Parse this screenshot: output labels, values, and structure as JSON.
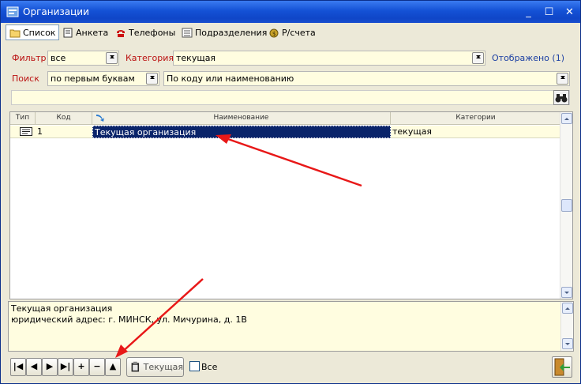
{
  "window": {
    "title": "Организации"
  },
  "titlebar_buttons": [
    "minimize",
    "maximize",
    "close"
  ],
  "tabs": [
    {
      "label": "Список",
      "icon": "folder-icon",
      "active": true
    },
    {
      "label": "Анкета",
      "icon": "book-icon",
      "active": false
    },
    {
      "label": "Телефоны",
      "icon": "phone-icon",
      "active": false
    },
    {
      "label": "Подразделения",
      "icon": "list-icon",
      "active": false
    },
    {
      "label": "Р/счета",
      "icon": "money-icon",
      "active": false
    }
  ],
  "filter": {
    "label": "Фильтр",
    "value": "все"
  },
  "category": {
    "label": "Категория",
    "value": "текущая"
  },
  "shown": {
    "text": "Отображено (1)"
  },
  "search": {
    "label": "Поиск",
    "mode": "по первым буквам",
    "field": "По коду или наименованию",
    "value": ""
  },
  "grid": {
    "columns": [
      "Тип",
      "Код",
      "Наименование",
      "Категории"
    ],
    "rows": [
      {
        "type_icon": "card-icon",
        "code": "1",
        "name": "Текущая организация",
        "category": "текущая"
      }
    ]
  },
  "memo": {
    "line1": "Текущая организация",
    "line2": "юридический адрес: г. МИНСК, ул. Мичурина, д. 1В"
  },
  "toolbar": {
    "first": "|◀",
    "prev": "◀",
    "next": "▶",
    "last": "▶|",
    "add": "+",
    "remove": "−",
    "up": "▲",
    "current_label": "Текущая",
    "all_label": "Все",
    "all_checked": false
  },
  "colors": {
    "accent_red": "#e81818",
    "title_blue": "#1451d6",
    "selection": "#0a246a",
    "field_bg": "#fffde0"
  }
}
